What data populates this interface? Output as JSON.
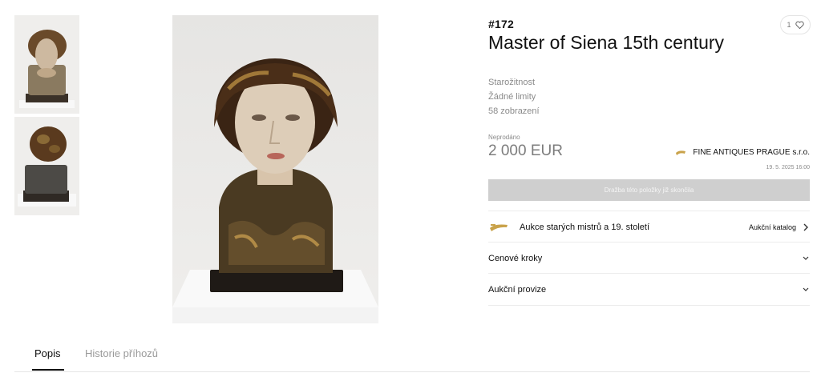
{
  "lot": {
    "number": "#172",
    "title": "Master of Siena 15th century"
  },
  "favorite": {
    "count": "1",
    "icon": "heart-icon"
  },
  "meta": {
    "category": "Starožitnost",
    "limits": "Žádné limity",
    "views": "58 zobrazení"
  },
  "pricing": {
    "status": "Neprodáno",
    "price": "2 000 EUR"
  },
  "seller": {
    "name": "FINE ANTIQUES PRAGUE s.r.o.",
    "date": "19. 5. 2025 16:00"
  },
  "bid_button": {
    "label": "Dražba této položky již skončila"
  },
  "auction": {
    "name": "Aukce starých mistrů a 19. století",
    "catalog_link": "Aukční katalog"
  },
  "accordions": {
    "price_steps": "Cenové kroky",
    "commission": "Aukční provize"
  },
  "tabs": {
    "description": "Popis",
    "bid_history": "Historie příhozů"
  },
  "colors": {
    "button_disabled": "#cfcfcf",
    "accent_gold": "#c9a24a",
    "muted_text": "#8a8a8a"
  }
}
